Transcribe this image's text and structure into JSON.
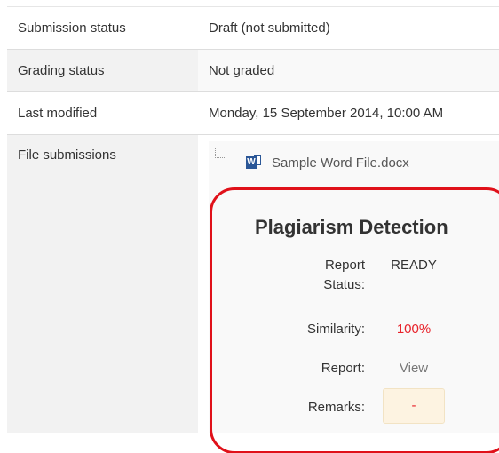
{
  "submission_table": {
    "rows": [
      {
        "label": "Submission status",
        "value": "Draft (not submitted)"
      },
      {
        "label": "Grading status",
        "value": "Not graded"
      },
      {
        "label": "Last modified",
        "value": "Monday, 15 September 2014, 10:00 AM"
      },
      {
        "label": "File submissions",
        "value": ""
      }
    ]
  },
  "file": {
    "name": "Sample Word File.docx",
    "icon": "word-document-icon"
  },
  "plagiarism": {
    "title": "Plagiarism Detection",
    "report_status_label_line1": "Report",
    "report_status_label_line2": "Status:",
    "report_status_value": "READY",
    "similarity_label": "Similarity:",
    "similarity_value": "100%",
    "report_label": "Report:",
    "report_link": "View",
    "remarks_label": "Remarks:",
    "remarks_value": "-"
  },
  "colors": {
    "highlight": "#e0111a",
    "similarity": "#e8222a",
    "remarks_bg": "#fdf3e1"
  }
}
